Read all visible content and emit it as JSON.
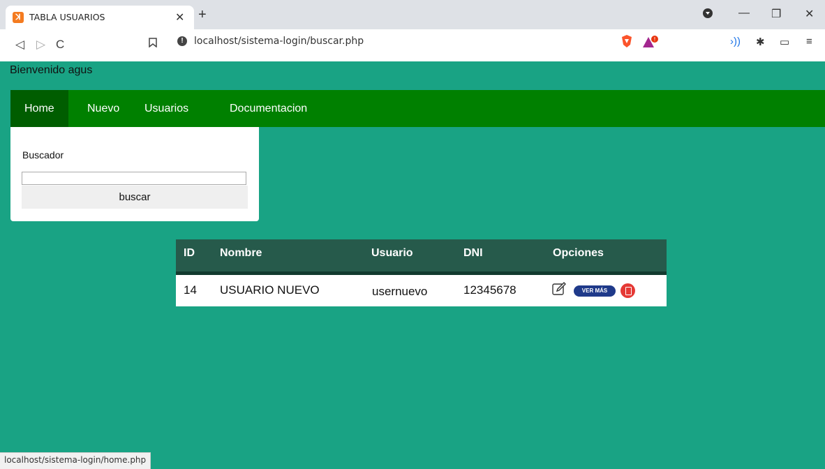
{
  "browser": {
    "tab_title": "TABLA USUARIOS",
    "favicon_icon": "xampp-icon",
    "url": "localhost/sistema-login/buscar.php",
    "status_url": "localhost/sistema-login/home.php"
  },
  "page": {
    "welcome": "Bienvenido agus"
  },
  "nav": {
    "items": [
      {
        "label": "Home",
        "active": true
      },
      {
        "label": "Nuevo",
        "active": false
      },
      {
        "label": "Usuarios",
        "active": false
      },
      {
        "label": "Documentacion",
        "active": false
      }
    ]
  },
  "search": {
    "label": "Buscador",
    "value": "",
    "button_label": "buscar"
  },
  "table": {
    "headers": [
      "ID",
      "Nombre",
      "Usuario",
      "DNI",
      "Opciones"
    ],
    "rows": [
      {
        "id": "14",
        "nombre": "USUARIO NUEVO",
        "usuario": "usernuevo",
        "dni": "12345678",
        "ver_mas_label": "VER MÁS"
      }
    ]
  },
  "colors": {
    "page_bg": "#19a384",
    "navbar": "#008000",
    "navbar_active": "#005d00",
    "table_header": "#265a4b",
    "ver_mas": "#1f3a8a",
    "delete": "#e53935"
  }
}
